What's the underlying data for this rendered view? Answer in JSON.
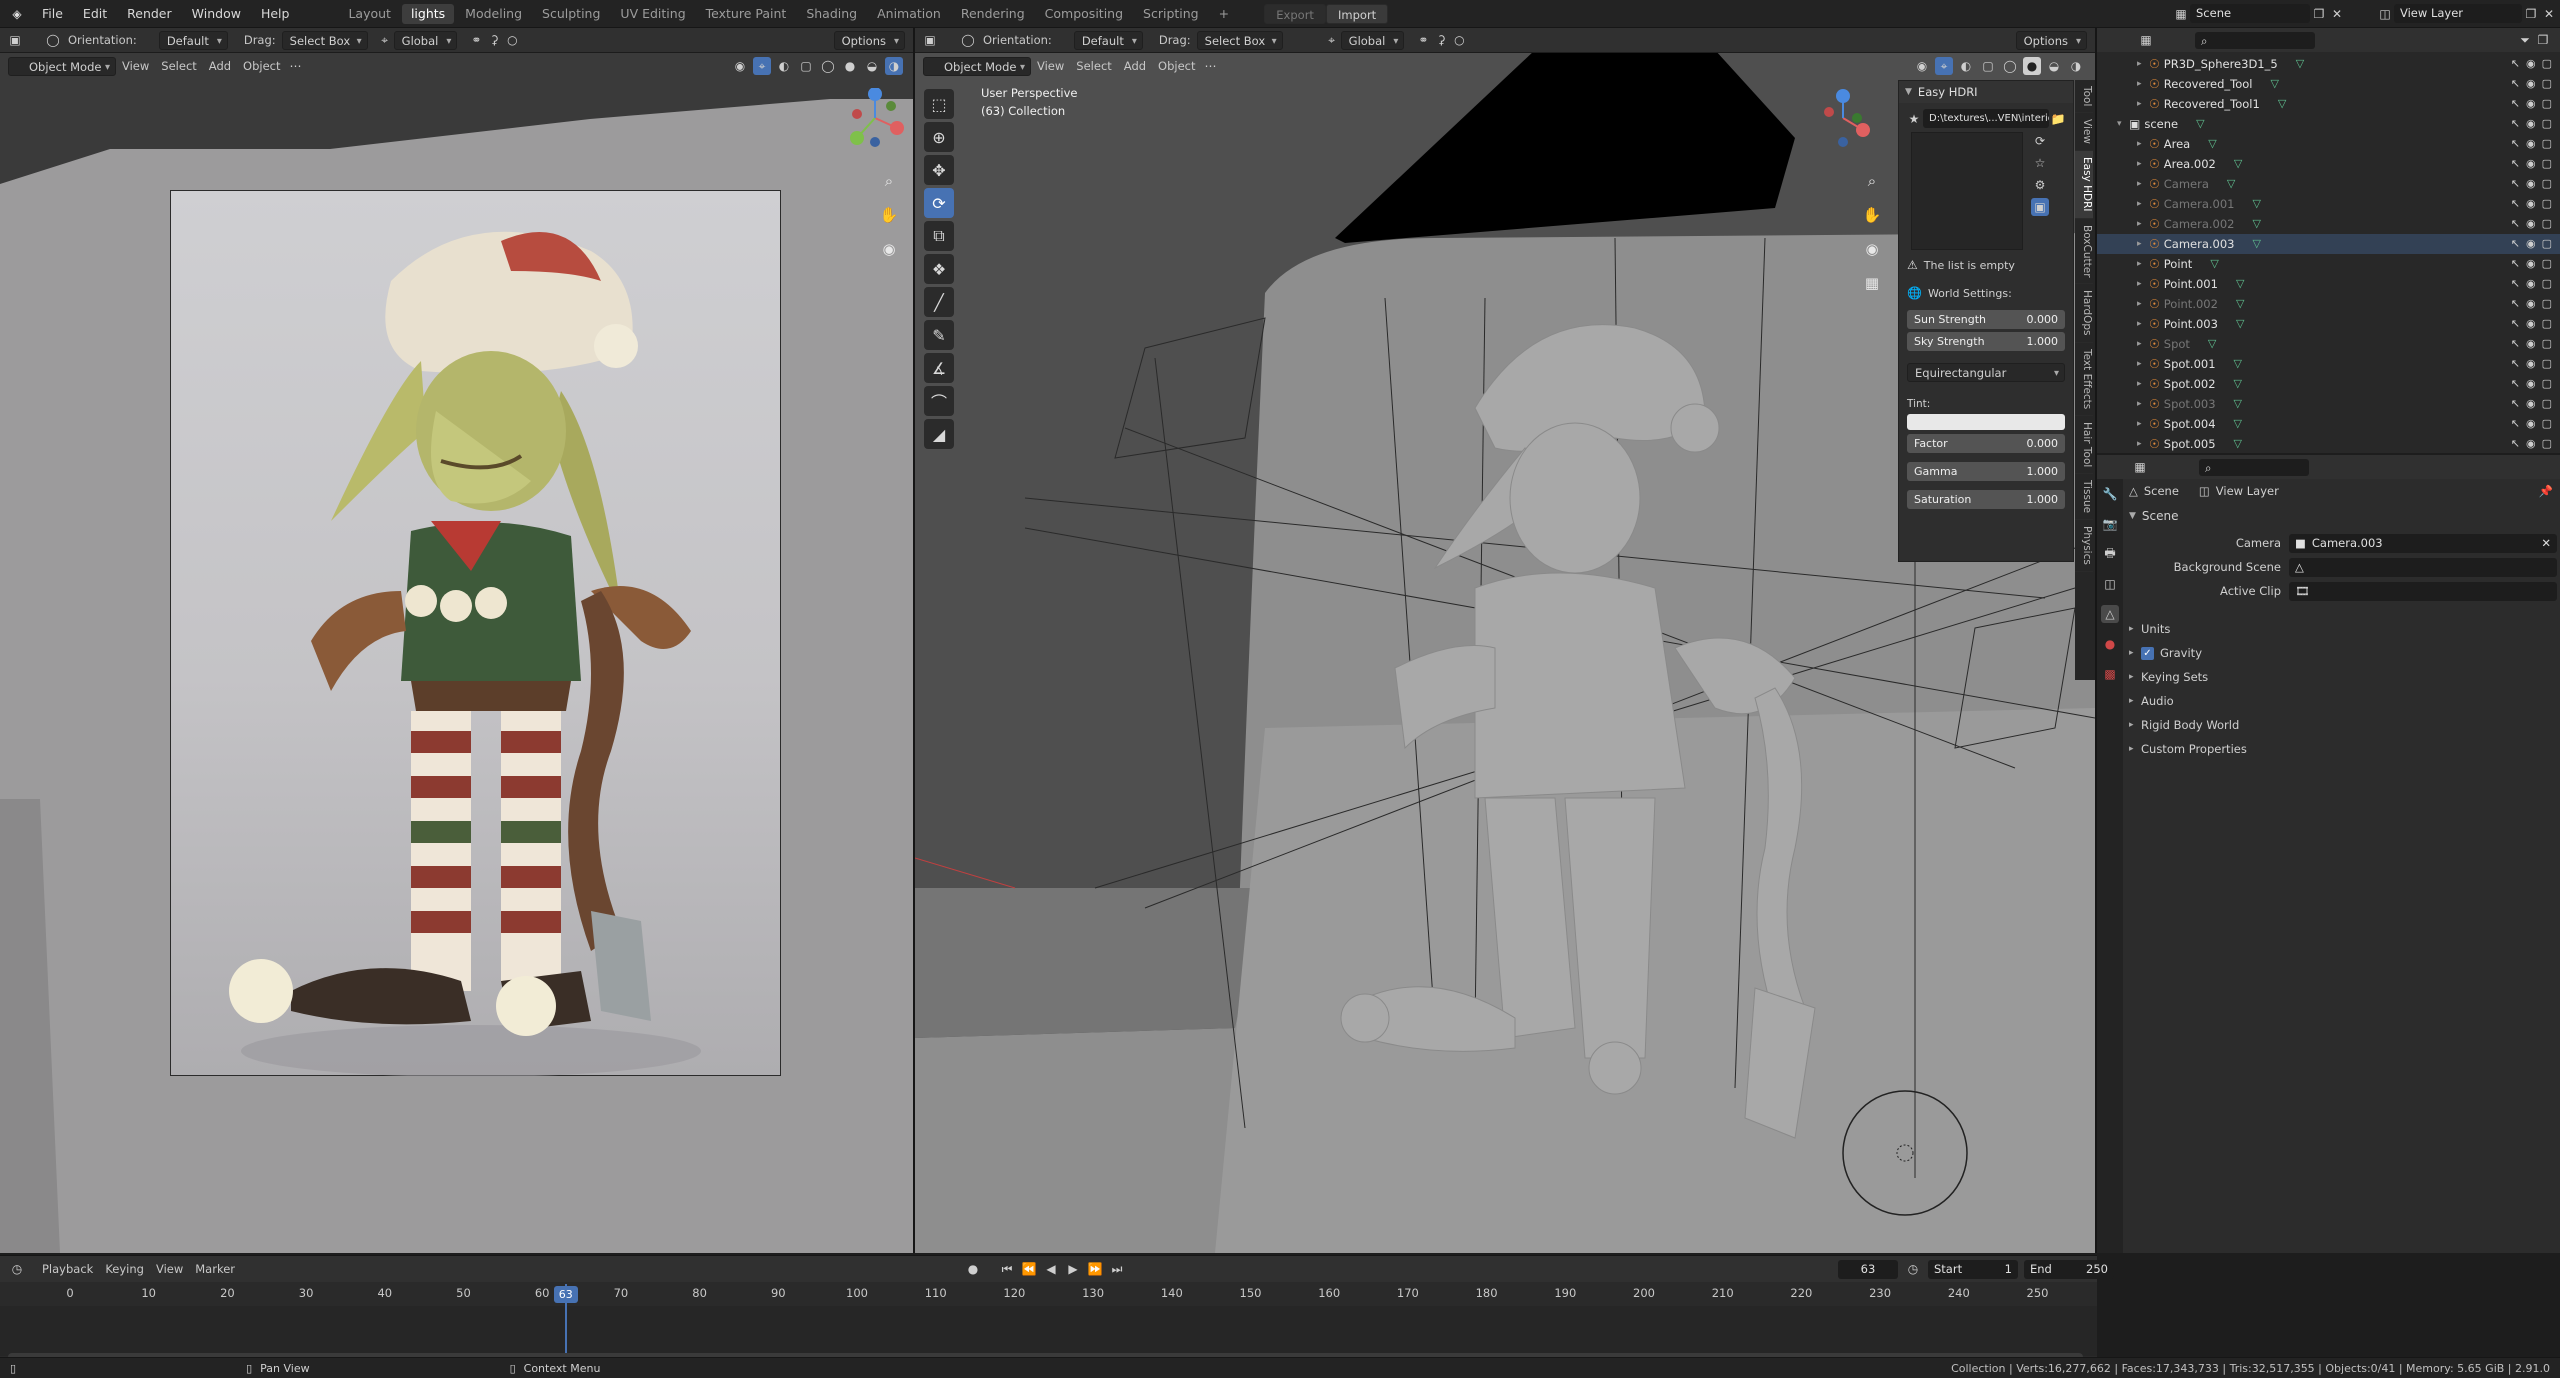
{
  "topbar": {
    "menus": [
      "File",
      "Edit",
      "Render",
      "Window",
      "Help"
    ],
    "workspaces": [
      "Layout",
      "lights",
      "Modeling",
      "Sculpting",
      "UV Editing",
      "Texture Paint",
      "Shading",
      "Animation",
      "Rendering",
      "Compositing",
      "Scripting"
    ],
    "active_workspace": "lights",
    "export_label": "Export",
    "import_label": "Import",
    "scene_name": "Scene",
    "view_layer": "View Layer"
  },
  "left_view": {
    "orientation_label": "Orientation:",
    "orientation_value": "Default",
    "drag_label": "Drag:",
    "drag_value": "Select Box",
    "transform_value": "Global",
    "options_label": "Options",
    "mode": "Object Mode",
    "menus": [
      "View",
      "Select",
      "Add",
      "Object"
    ]
  },
  "right_view": {
    "orientation_label": "Orientation:",
    "orientation_value": "Default",
    "drag_label": "Drag:",
    "drag_value": "Select Box",
    "transform_value": "Global",
    "options_label": "Options",
    "mode": "Object Mode",
    "menus": [
      "View",
      "Select",
      "Add",
      "Object"
    ],
    "overlay_title": "User Perspective",
    "overlay_collection": "(63) Collection"
  },
  "easy_hdri": {
    "title": "Easy HDRI",
    "path": "D:\\textures\\...VEN\\interior\\",
    "empty_msg": "The list is empty",
    "world_settings": "World Settings:",
    "sun_strength_label": "Sun Strength",
    "sun_strength": "0.000",
    "sky_strength_label": "Sky Strength",
    "sky_strength": "1.000",
    "projection": "Equirectangular",
    "tint_label": "Tint:",
    "factor_label": "Factor",
    "factor": "0.000",
    "gamma_label": "Gamma",
    "gamma": "1.000",
    "saturation_label": "Saturation",
    "saturation": "1.000"
  },
  "n_panel_tabs": [
    "Tool",
    "View",
    "Easy HDRI",
    "BoxCutter",
    "HardOps",
    "Text Effects",
    "Hair Tool",
    "Tissue",
    "Physics"
  ],
  "outliner": {
    "rows": [
      {
        "name": "PR3D_Sphere3D1_5",
        "dim": false
      },
      {
        "name": "Recovered_Tool",
        "dim": false
      },
      {
        "name": "Recovered_Tool1",
        "dim": false
      },
      {
        "name": "scene",
        "dim": false
      },
      {
        "name": "Area",
        "dim": false
      },
      {
        "name": "Area.002",
        "dim": false
      },
      {
        "name": "Camera",
        "dim": true
      },
      {
        "name": "Camera.001",
        "dim": true
      },
      {
        "name": "Camera.002",
        "dim": true
      },
      {
        "name": "Camera.003",
        "dim": false
      },
      {
        "name": "Point",
        "dim": false
      },
      {
        "name": "Point.001",
        "dim": false
      },
      {
        "name": "Point.002",
        "dim": true
      },
      {
        "name": "Point.003",
        "dim": false
      },
      {
        "name": "Spot",
        "dim": true
      },
      {
        "name": "Spot.001",
        "dim": false
      },
      {
        "name": "Spot.002",
        "dim": false
      },
      {
        "name": "Spot.003",
        "dim": true
      },
      {
        "name": "Spot.004",
        "dim": false
      },
      {
        "name": "Spot.005",
        "dim": false
      }
    ]
  },
  "properties": {
    "breadcrumb_scene": "Scene",
    "breadcrumb_layer": "View Layer",
    "section": "Scene",
    "camera_label": "Camera",
    "camera_value": "Camera.003",
    "bg_scene_label": "Background Scene",
    "active_clip_label": "Active Clip",
    "panels": [
      "Units",
      "Gravity",
      "Keying Sets",
      "Audio",
      "Rigid Body World",
      "Custom Properties"
    ]
  },
  "timeline": {
    "menus": [
      "Playback",
      "Keying",
      "View",
      "Marker"
    ],
    "current_frame": "63",
    "start_label": "Start",
    "start": "1",
    "end_label": "End",
    "end": "250",
    "ticks": [
      "0",
      "10",
      "20",
      "30",
      "40",
      "50",
      "60",
      "70",
      "80",
      "90",
      "100",
      "110",
      "120",
      "130",
      "140",
      "150",
      "160",
      "170",
      "180",
      "190",
      "200",
      "210",
      "220",
      "230",
      "240",
      "250"
    ]
  },
  "statusbar": {
    "pan_view": "Pan View",
    "context_menu": "Context Menu",
    "stats": "Collection | Verts:16,277,662 | Faces:17,343,733 | Tris:32,517,355 | Objects:0/41 | Memory: 5.65 GiB | 2.91.0"
  },
  "colors": {
    "accent": "#4772b3",
    "panel": "#303030",
    "bg": "#1d1d1d",
    "viewport_left": "#3a3a3a",
    "viewport_right": "#5e5e5e"
  }
}
